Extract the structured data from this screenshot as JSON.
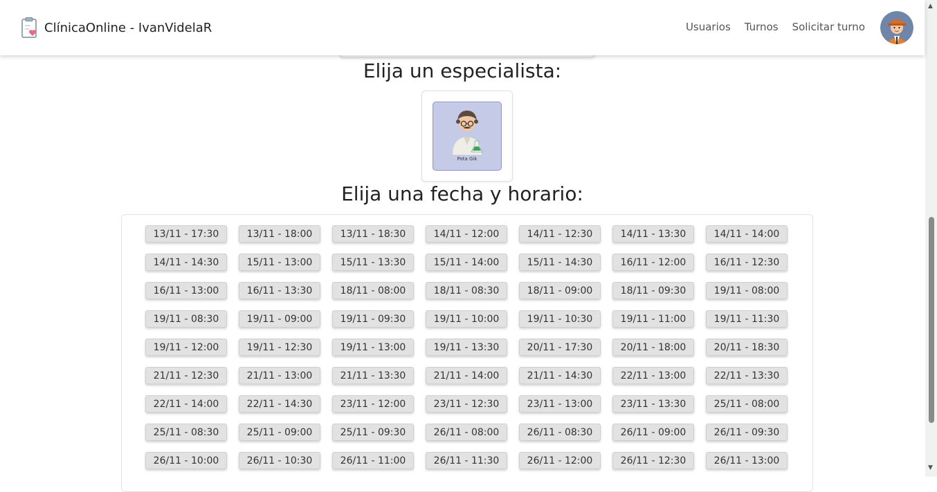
{
  "navbar": {
    "brand": "ClínicaOnline - IvanVidelaR",
    "links": [
      "Usuarios",
      "Turnos",
      "Solicitar turno"
    ]
  },
  "specialist_section": {
    "title": "Elija un especialista:",
    "specialists": [
      {
        "name": "Pota Gik"
      }
    ]
  },
  "schedule_section": {
    "title": "Elija una fecha y horario:",
    "slots": [
      "13/11 - 17:30",
      "13/11 - 18:00",
      "13/11 - 18:30",
      "14/11 - 12:00",
      "14/11 - 12:30",
      "14/11 - 13:30",
      "14/11 - 14:00",
      "14/11 - 14:30",
      "15/11 - 13:00",
      "15/11 - 13:30",
      "15/11 - 14:00",
      "15/11 - 14:30",
      "16/11 - 12:00",
      "16/11 - 12:30",
      "16/11 - 13:00",
      "16/11 - 13:30",
      "18/11 - 08:00",
      "18/11 - 08:30",
      "18/11 - 09:00",
      "18/11 - 09:30",
      "19/11 - 08:00",
      "19/11 - 08:30",
      "19/11 - 09:00",
      "19/11 - 09:30",
      "19/11 - 10:00",
      "19/11 - 10:30",
      "19/11 - 11:00",
      "19/11 - 11:30",
      "19/11 - 12:00",
      "19/11 - 12:30",
      "19/11 - 13:00",
      "19/11 - 13:30",
      "20/11 - 17:30",
      "20/11 - 18:00",
      "20/11 - 18:30",
      "21/11 - 12:30",
      "21/11 - 13:00",
      "21/11 - 13:30",
      "21/11 - 14:00",
      "21/11 - 14:30",
      "22/11 - 13:00",
      "22/11 - 13:30",
      "22/11 - 14:00",
      "22/11 - 14:30",
      "23/11 - 12:00",
      "23/11 - 12:30",
      "23/11 - 13:00",
      "23/11 - 13:30",
      "25/11 - 08:00",
      "25/11 - 08:30",
      "25/11 - 09:00",
      "25/11 - 09:30",
      "26/11 - 08:00",
      "26/11 - 08:30",
      "26/11 - 09:00",
      "26/11 - 09:30",
      "26/11 - 10:00",
      "26/11 - 10:30",
      "26/11 - 11:00",
      "26/11 - 11:30",
      "26/11 - 12:00",
      "26/11 - 12:30",
      "26/11 - 13:00"
    ]
  },
  "icons": {
    "brand": "clipboard-heart-icon",
    "avatar": "user-avatar",
    "specialist": "doctor-avatar"
  }
}
